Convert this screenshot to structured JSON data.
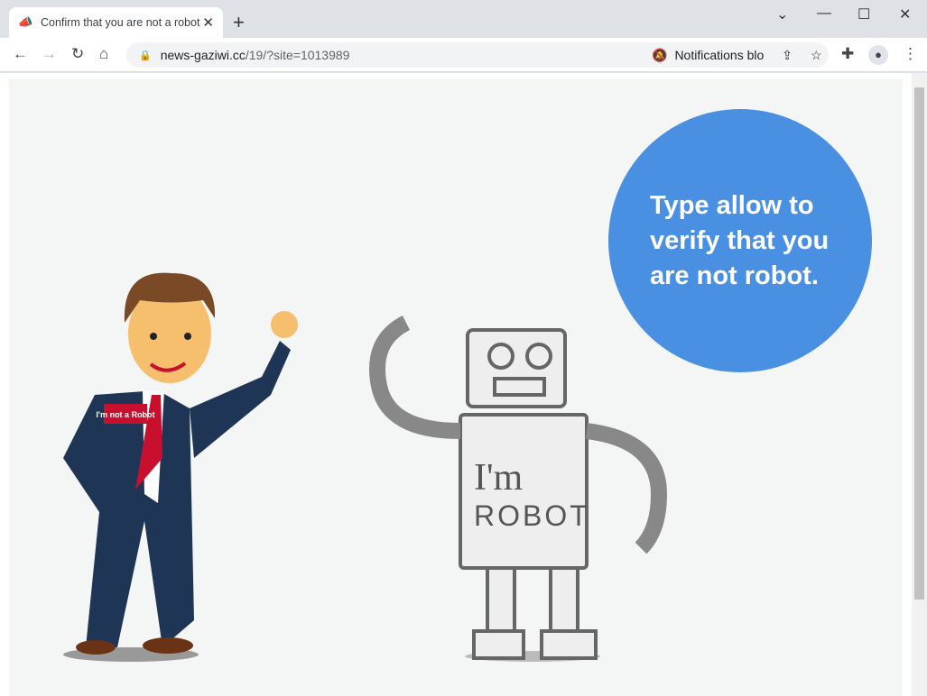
{
  "tab": {
    "title": "Confirm that you are not a robot",
    "close": "✕",
    "favicon": "megaphone-icon"
  },
  "new_tab": "+",
  "window": {
    "minimize": "—",
    "maximize": "☐",
    "close": "✕",
    "tabsearch": "⌄"
  },
  "nav": {
    "back": "←",
    "forward": "→",
    "reload": "↻",
    "home": "⌂"
  },
  "url": {
    "host": "news-gaziwi.cc",
    "path": "/19/?site=1013989"
  },
  "omnibox": {
    "notifications": "Notifications blo"
  },
  "page": {
    "message": "Type allow to verify that you are not robot.",
    "man_badge": "I'm not a Robot",
    "robot_text1": "I'm",
    "robot_text2": "ROBOT"
  },
  "colors": {
    "bubble": "#4a90e2",
    "suit": "#1f3556",
    "tie": "#c8102e"
  }
}
